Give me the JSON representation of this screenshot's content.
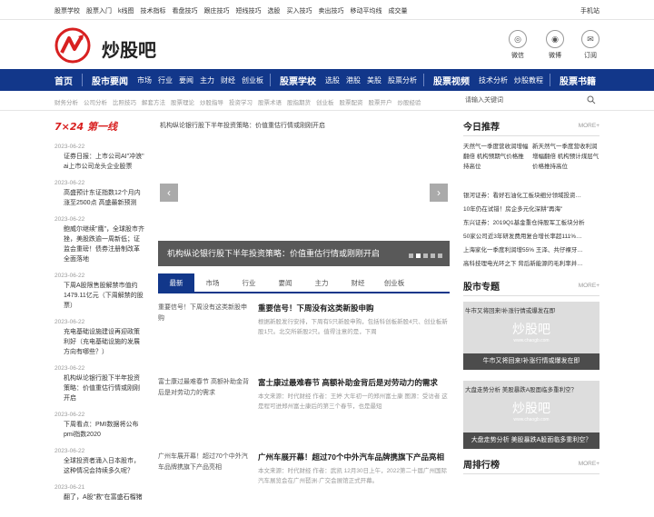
{
  "topbar": {
    "links": [
      "股票学校",
      "股票入门",
      "k线图",
      "技术指标",
      "看盘技巧",
      "跟庄技巧",
      "短线技巧",
      "选股",
      "买入技巧",
      "卖出技巧",
      "移动平均线",
      "成交量"
    ],
    "mobile": "手机站"
  },
  "brand": {
    "name": "炒股吧"
  },
  "social": [
    {
      "icon": "wechat-icon",
      "label": "微信"
    },
    {
      "icon": "weibo-icon",
      "label": "微博"
    },
    {
      "icon": "mail-icon",
      "label": "订阅"
    }
  ],
  "nav": {
    "home": "首页",
    "market_news": "股市要闻",
    "market_items": [
      "市场",
      "行业",
      "要闻",
      "主力",
      "财经",
      "创业板"
    ],
    "school": "股票学校",
    "school_items": [
      "选股",
      "港股",
      "美股",
      "股票分析"
    ],
    "video": "股票视频",
    "video_items": [
      "技术分析",
      "炒股教程"
    ],
    "books": "股票书籍"
  },
  "subnav": {
    "items": [
      "财务分析",
      "公司分析",
      "比照技巧",
      "解套方法",
      "股票理论",
      "炒股指导",
      "投资学习",
      "股票术语",
      "股指期货",
      "创业板",
      "股票配资",
      "股票开户",
      "炒股经验"
    ],
    "search_placeholder": "请输入关键词"
  },
  "firstline": {
    "title": "7×24 第一线",
    "items": [
      {
        "date": "2023-06-22",
        "title": "证券日报：上市公司AI\"冲浪\" ai上市公司龙头企业股票"
      },
      {
        "date": "2023-06-22",
        "title": "高盛预计东证指数12个月内涨至2500点 高盛最新预测"
      },
      {
        "date": "2023-06-22",
        "title": "鲍威尔继续\"鹰\"，全球股市齐挫，美股跌逾一周新低；证监会重磅！债券注册制改革全面落地"
      },
      {
        "date": "2023-06-22",
        "title": "下周A股限售股解禁市值约1479.11亿元（下周解禁的股票）"
      },
      {
        "date": "2023-06-22",
        "title": "充电基础设施建设再迎政策利好（充电基础设施的发展方向有哪些？）"
      },
      {
        "date": "2023-06-22",
        "title": "机构纵论银行股下半年投资策略：价值重估行情或刚刚开启"
      },
      {
        "date": "2023-06-22",
        "title": "下周看点：PMI数据将公布 pmi指数2020"
      },
      {
        "date": "2023-06-22",
        "title": "全球投资者涌入日本股市，这种情况会持续多久呢？"
      },
      {
        "date": "2023-06-21",
        "title": "翻了，A股\"救\"在富盛石榴猪"
      }
    ]
  },
  "slider": {
    "top_caption": "机构纵论银行股下半年投资策略：价值重估行情或刚刚开启",
    "caption": "机构纵论银行股下半年投资策略：价值重估行情或刚刚开启",
    "prev": "‹",
    "next": "›"
  },
  "tabs": [
    "最新",
    "市场",
    "行业",
    "要闻",
    "主力",
    "财经",
    "创业板"
  ],
  "articles": [
    {
      "thumb": "重要信号！下周没有这类新股申购",
      "title": "重要信号！下周没有这类新股申购",
      "summary": "根据新股发行安排，下周有5只新股申购，包括科创板新股4只、创业板新股1只。北交所新股2只。值得注意的是，下周"
    },
    {
      "thumb": "富士康过最难春节 高额补助金背后是对劳动力的需求",
      "title": "富士康过最难春节 高额补助金背后是对劳动力的需求",
      "summary": "本文来源：时代财经 作者：王婷 大年初一的郑州富士康 图源：受访者 这是程可进郑州富士康后的第三个春节，也是最短"
    },
    {
      "thumb": "广州车展开幕！超过70个中外汽车品牌携旗下产品亮相",
      "title": "广州车展开幕！超过70个中外汽车品牌携旗下产品亮相",
      "summary": "本文来源：时代财经 作者：武凯 12月30日上午，2022第二十届广州国际汽车展览会在广州琶洲·广交会展馆正式开幕。"
    }
  ],
  "today": {
    "title": "今日推荐",
    "more": "MORE+",
    "left": "天然气一季度营收润增幅翻倍 机构预期气价格推持高位",
    "right": "新天然气一季度营收利润增幅翻倍 机构预计煤层气价格推持高位",
    "list": [
      "银河证券：看好石油化工板块细分领域投资…",
      "10年仍在试错！房企多元化深耕\"再海\"",
      "东兴证券：2019Q1基金重仓持股军工板块分析",
      "50家公司近3年研发费用复合增长率超111%…",
      "上海家化一季度利润增55% 王泽、共仔裸牙…",
      "高科技理电光环之下 背后新能源的毛利率并…"
    ]
  },
  "topics": {
    "title": "股市专题",
    "more": "MORE+",
    "items": [
      {
        "top": "牛市又将回来!补涨行情或爆发在即",
        "wm": "炒股吧",
        "wms": "www.chaogb.com",
        "bar": "牛市又将回来!补涨行情或爆发在即"
      },
      {
        "top": "大盘走势分析 美股暴跌A股面临多重利空？",
        "wm": "炒股吧",
        "wms": "www.chaogb.com",
        "bar": "大盘走势分析 美股暴跌A股面临多重利空？"
      }
    ]
  },
  "weekly": {
    "title": "周排行榜",
    "more": "MORE+"
  }
}
